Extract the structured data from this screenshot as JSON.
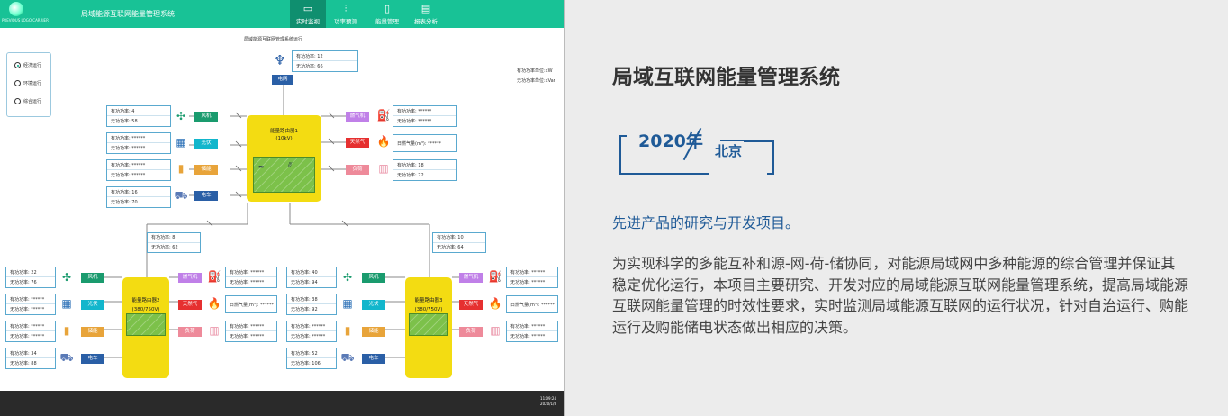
{
  "app": {
    "logo_text": "PREVIOUS LOGO CARRIER",
    "title": "局域能源互联网能量管理系统",
    "nav": [
      {
        "label": "实时监视",
        "icon": "monitor-icon",
        "active": true
      },
      {
        "label": "功率预测",
        "icon": "sliders-icon",
        "active": false
      },
      {
        "label": "能量管理",
        "icon": "battery-icon",
        "active": false
      },
      {
        "label": "报表分析",
        "icon": "report-icon",
        "active": false
      }
    ],
    "subtitle": "局域能源互联网管理系统运行",
    "units": [
      "有功功率单位:kW",
      "无功功率单位:kVar"
    ],
    "modes": [
      "经济运行",
      "环境运行",
      "综合运行"
    ],
    "selected_mode": "经济运行",
    "grid": {
      "label": "电网",
      "p": "有功功率: 12",
      "q": "无功功率: 66"
    },
    "router1": {
      "name": "能量路由器1",
      "voltage": "(10kV)",
      "left": [
        {
          "label": "风机",
          "p": "有功功率: 4",
          "q": "无功功率: 58"
        },
        {
          "label": "光伏",
          "p": "有功功率: ******",
          "q": "无功功率: ******"
        },
        {
          "label": "储能",
          "p": "有功功率: ******",
          "q": "无功功率: ******"
        },
        {
          "label": "电车",
          "p": "有功功率: 16",
          "q": "无功功率: 70"
        }
      ],
      "right": [
        {
          "label": "燃气机",
          "p": "有功功率: ******",
          "q": "无功功率: ******"
        },
        {
          "label": "天然气",
          "single": "日燃气量(m³): ******"
        },
        {
          "label": "负荷",
          "p": "有功功率: 18",
          "q": "无功功率: 72"
        }
      ]
    },
    "link_boxes": [
      {
        "p": "有功功率: 8",
        "q": "无功功率: 62"
      },
      {
        "p": "有功功率: 10",
        "q": "无功功率: 64"
      }
    ],
    "router2": {
      "name": "能量路由器2",
      "voltage": "(380/750V)",
      "left": [
        {
          "label": "风机",
          "p": "有功功率: 22",
          "q": "无功功率: 76"
        },
        {
          "label": "光伏",
          "p": "有功功率: ******",
          "q": "无功功率: ******"
        },
        {
          "label": "储能",
          "p": "有功功率: ******",
          "q": "无功功率: ******"
        },
        {
          "label": "电车",
          "p": "有功功率: 34",
          "q": "无功功率: 88"
        }
      ],
      "right": [
        {
          "label": "燃气机",
          "p": "有功功率: ******",
          "q": "无功功率: ******"
        },
        {
          "label": "天然气",
          "single": "日燃气量(m³): ******"
        },
        {
          "label": "负荷",
          "p": "有功功率: ******",
          "q": "无功功率: ******"
        }
      ]
    },
    "router3": {
      "name": "能量路由器3",
      "voltage": "(380/750V)",
      "left": [
        {
          "label": "风机",
          "p": "有功功率: 40",
          "q": "无功功率: 94"
        },
        {
          "label": "光伏",
          "p": "有功功率: 38",
          "q": "无功功率: 92"
        },
        {
          "label": "储能",
          "p": "有功功率: ******",
          "q": "无功功率: ******"
        },
        {
          "label": "电车",
          "p": "有功功率: 52",
          "q": "无功功率: 106"
        }
      ],
      "right": [
        {
          "label": "燃气机",
          "p": "有功功率: ******",
          "q": "无功功率: ******"
        },
        {
          "label": "天然气",
          "single": "日燃气量(m³): ******"
        },
        {
          "label": "负荷",
          "p": "有功功率: ******",
          "q": "无功功率: ******"
        }
      ]
    },
    "clock": {
      "time": "11:09:24",
      "date": "2020/1/8"
    }
  },
  "panel": {
    "title": "局域互联网能量管理系统",
    "year": "2020年",
    "city": "北京",
    "lead": "先进产品的研究与开发项目。",
    "body": "为实现科学的多能互补和源-网-荷-储协同，对能源局域网中多种能源的综合管理并保证其稳定优化运行，本项目主要研究、开发对应的局域能源互联网能量管理系统，提高局域能源互联网能量管理的时效性要求，实时监测局域能源互联网的运行状况，针对自治运行、购能运行及购能储电状态做出相应的决策。"
  },
  "colors": {
    "topbar": "#18c296",
    "wind_tag": "#1a9b6e",
    "pv_tag": "#12b6cc",
    "storage_tag": "#e8a43a",
    "ev_tag": "#2a5fa6",
    "gas_gen_tag": "#c080e8",
    "natural_gas_tag": "#e63030",
    "load_tag": "#ee8a9a",
    "router_yellow": "#f3dc12",
    "router_green": "#7cc14a",
    "accent_blue": "#1f5a97"
  }
}
